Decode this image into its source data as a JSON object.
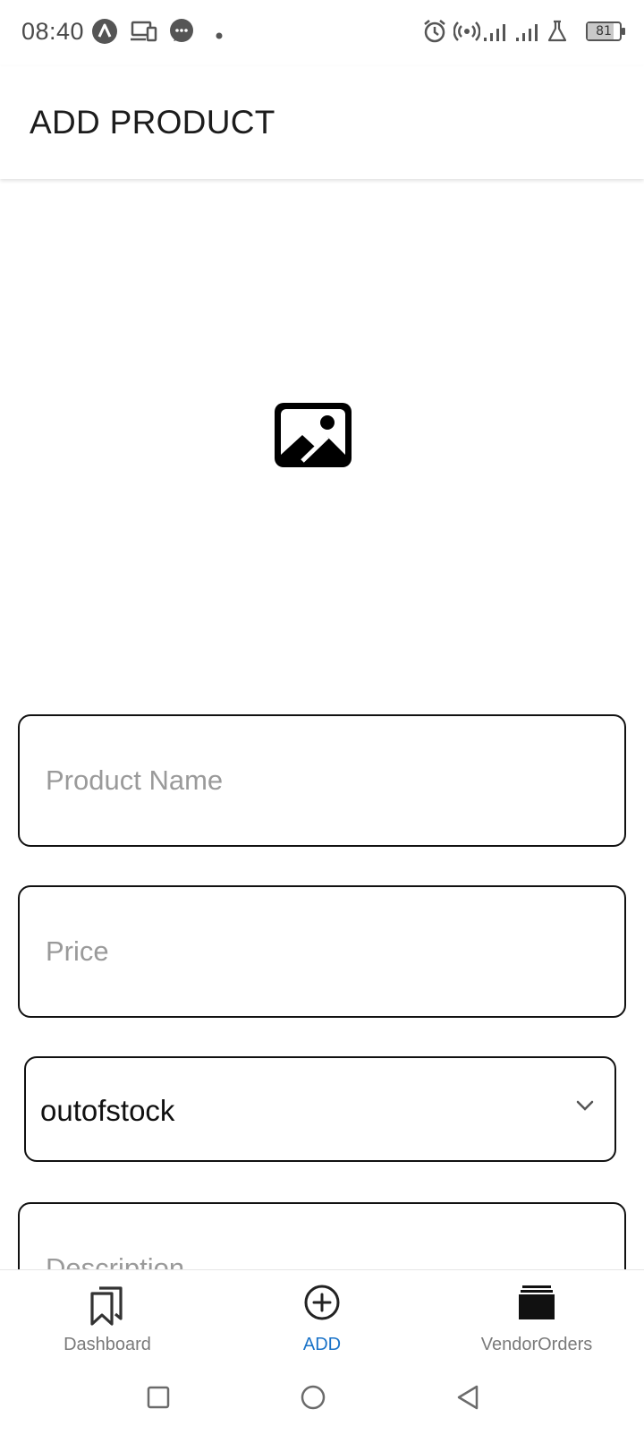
{
  "status_bar": {
    "time": "08:40",
    "battery_level": "81",
    "icons": [
      "app-a-icon",
      "devices-icon",
      "messages-icon",
      "notification-dot-icon",
      "alarm-icon",
      "hotspot-icon",
      "signal-1-icon",
      "signal-2-icon",
      "lab-icon",
      "battery-icon"
    ]
  },
  "app_bar": {
    "title": "ADD PRODUCT"
  },
  "image_picker": {
    "icon": "image-icon"
  },
  "form": {
    "product_name": {
      "value": "",
      "placeholder": "Product Name"
    },
    "price": {
      "value": "",
      "placeholder": "Price"
    },
    "stock_status": {
      "value": "outofstock",
      "icon": "chevron-down-icon"
    },
    "description": {
      "value": "",
      "placeholder": "Description"
    }
  },
  "bottom_nav": {
    "items": [
      {
        "label": "Dashboard",
        "icon": "bookmarks-icon",
        "active": false
      },
      {
        "label": "ADD",
        "icon": "add-circle-icon",
        "active": true
      },
      {
        "label": "VendorOrders",
        "icon": "stack-icon",
        "active": false
      }
    ]
  },
  "system_nav": {
    "buttons": [
      "recents-button",
      "home-button",
      "back-button"
    ]
  },
  "colors": {
    "accent": "#1a73c8",
    "border": "#111111",
    "placeholder": "#9a9a9a",
    "inactive_label": "#7a7a7a"
  }
}
